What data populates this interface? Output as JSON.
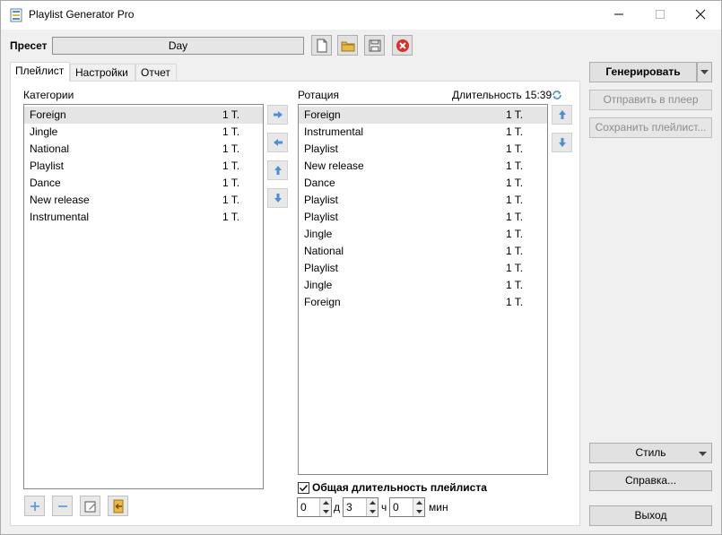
{
  "window": {
    "title": "Playlist Generator Pro"
  },
  "preset": {
    "label": "Пресет",
    "value": "Day"
  },
  "tabs": [
    {
      "label": "Плейлист",
      "active": true
    },
    {
      "label": "Настройки",
      "active": false
    },
    {
      "label": "Отчет",
      "active": false
    }
  ],
  "categories": {
    "header": "Категории",
    "items": [
      {
        "name": "Foreign",
        "count": "1 T."
      },
      {
        "name": "Jingle",
        "count": "1 T."
      },
      {
        "name": "National",
        "count": "1 T."
      },
      {
        "name": "Playlist",
        "count": "1 T."
      },
      {
        "name": "Dance",
        "count": "1 T."
      },
      {
        "name": "New release",
        "count": "1 T."
      },
      {
        "name": "Instrumental",
        "count": "1 T."
      }
    ]
  },
  "rotation": {
    "header": "Ротация",
    "duration_label": "Длительность 15:39",
    "items": [
      {
        "name": "Foreign",
        "count": "1 T."
      },
      {
        "name": "Instrumental",
        "count": "1 T."
      },
      {
        "name": "Playlist",
        "count": "1 T."
      },
      {
        "name": "New release",
        "count": "1 T."
      },
      {
        "name": "Dance",
        "count": "1 T."
      },
      {
        "name": "Playlist",
        "count": "1 T."
      },
      {
        "name": "Playlist",
        "count": "1 T."
      },
      {
        "name": "Jingle",
        "count": "1 T."
      },
      {
        "name": "National",
        "count": "1 T."
      },
      {
        "name": "Playlist",
        "count": "1 T."
      },
      {
        "name": "Jingle",
        "count": "1 T."
      },
      {
        "name": "Foreign",
        "count": "1 T."
      }
    ]
  },
  "total_duration": {
    "checkbox_label": "Общая длительность плейлиста",
    "checked": true,
    "days_value": "0",
    "days_unit": "д",
    "hours_value": "3",
    "hours_unit": "ч",
    "minutes_value": "0",
    "minutes_unit": "мин"
  },
  "actions": {
    "generate": "Генерировать",
    "send_to_player": "Отправить в плеер",
    "save_playlist": "Сохранить плейлист...",
    "style": "Стиль",
    "help": "Справка...",
    "exit": "Выход"
  },
  "colors": {
    "accent_blue": "#4a90d9",
    "selected_row": "#e5e5e5",
    "delete_red": "#d9302c",
    "folder_yellow": "#e8b84a"
  }
}
